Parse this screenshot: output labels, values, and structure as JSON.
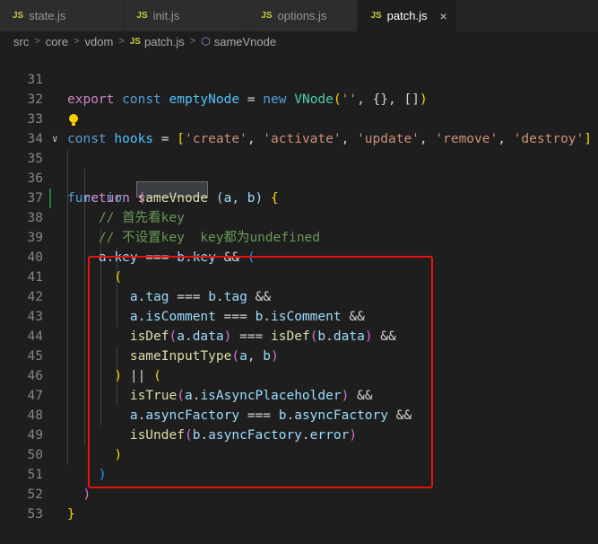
{
  "tabs": [
    {
      "badge": "JS",
      "label": "state.js",
      "active": false
    },
    {
      "badge": "JS",
      "label": "init.js",
      "active": false
    },
    {
      "badge": "JS",
      "label": "options.js",
      "active": false
    },
    {
      "badge": "JS",
      "label": "patch.js",
      "active": true
    }
  ],
  "breadcrumb": [
    "src",
    "core",
    "vdom",
    "patch.js",
    "sameVnode"
  ],
  "breadcrumb_badge": "JS",
  "close_glyph": "×",
  "line_numbers": [
    "31",
    "32",
    "33",
    "34",
    "35",
    "36",
    "37",
    "38",
    "39",
    "40",
    "41",
    "42",
    "43",
    "44",
    "45",
    "46",
    "47",
    "48",
    "49",
    "50",
    "51",
    "52",
    "53"
  ],
  "code": {
    "l31": [
      "export",
      "const",
      "emptyNode",
      "=",
      "new",
      "VNode",
      "(",
      "''",
      ", {}, []",
      ")"
    ],
    "l33": [
      "const",
      "hooks",
      "=",
      "[",
      "'create'",
      ", ",
      "'activate'",
      ", ",
      "'update'",
      ", ",
      "'remove'",
      ", ",
      "'destroy'",
      "]"
    ],
    "l35": [
      "function",
      "sameVnode",
      "(a, b)",
      "{"
    ],
    "l36": [
      "return",
      "("
    ],
    "l37": "// 首先看key",
    "l38": "// 不设置key  key都为undefined",
    "l39": [
      "a",
      ".",
      "key",
      "===",
      "b",
      ".",
      "key",
      "&&",
      "("
    ],
    "l40": "(",
    "l41": [
      "a",
      ".",
      "tag",
      "===",
      "b",
      ".",
      "tag",
      "&&"
    ],
    "l42": [
      "a",
      ".",
      "isComment",
      "===",
      "b",
      ".",
      "isComment",
      "&&"
    ],
    "l43": [
      "isDef",
      "(",
      "a",
      ".",
      "data",
      ")",
      "===",
      "isDef",
      "(",
      "b",
      ".",
      "data",
      ")",
      "&&"
    ],
    "l44": [
      "sameInputType",
      "(",
      "a",
      ", ",
      "b",
      ")"
    ],
    "l45": [
      ")",
      "||",
      "("
    ],
    "l46": [
      "isTrue",
      "(",
      "a",
      ".",
      "isAsyncPlaceholder",
      ")",
      "&&"
    ],
    "l47": [
      "a",
      ".",
      "asyncFactory",
      "===",
      "b",
      ".",
      "asyncFactory",
      "&&"
    ],
    "l48": [
      "isUndef",
      "(",
      "b",
      ".",
      "asyncFactory",
      ".",
      "error",
      ")"
    ],
    "l49": ")",
    "l50": ")",
    "l51": ")",
    "l52": "}"
  },
  "colors": {
    "highlight_box": "#e8140c",
    "keyword": "#c586c0",
    "storage": "#569cd6",
    "function": "#dcdcaa",
    "variable": "#9cdcfe",
    "string": "#ce9178",
    "comment": "#6a9955"
  },
  "icons": {
    "fold": "chevron-down-icon",
    "symbol": "cube-icon",
    "lightbulb": "lightbulb-icon"
  }
}
